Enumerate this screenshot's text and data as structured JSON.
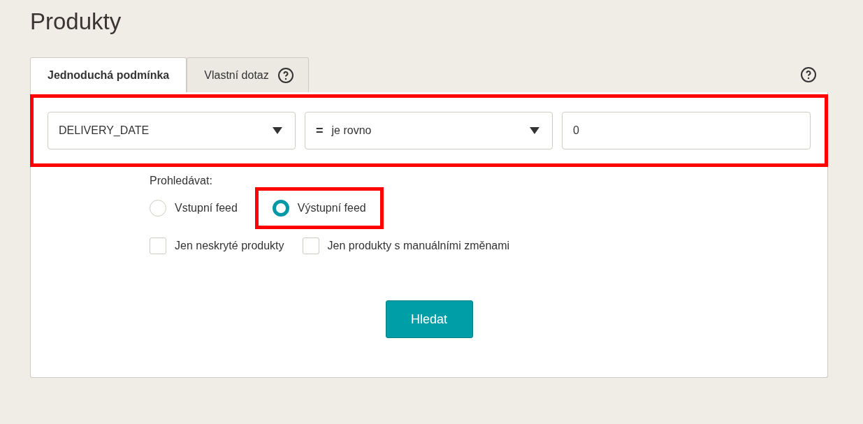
{
  "page_title": "Produkty",
  "tabs": [
    {
      "label": "Jednoduchá podmínka",
      "selected": true,
      "help": false
    },
    {
      "label": "Vlastní dotaz",
      "selected": false,
      "help": true
    }
  ],
  "filter": {
    "highlighted": true,
    "field": "DELIVERY_DATE",
    "operator_symbol": "=",
    "operator": "je rovno",
    "value": "0"
  },
  "search_in": {
    "label": "Prohledávat:",
    "options": [
      {
        "label": "Vstupní feed",
        "selected": false,
        "highlighted": false
      },
      {
        "label": "Výstupní feed",
        "selected": true,
        "highlighted": true
      }
    ]
  },
  "checkboxes": [
    {
      "label": "Jen neskryté produkty",
      "checked": false
    },
    {
      "label": "Jen produkty s manuálními změnami",
      "checked": false
    }
  ],
  "button": "Hledat"
}
